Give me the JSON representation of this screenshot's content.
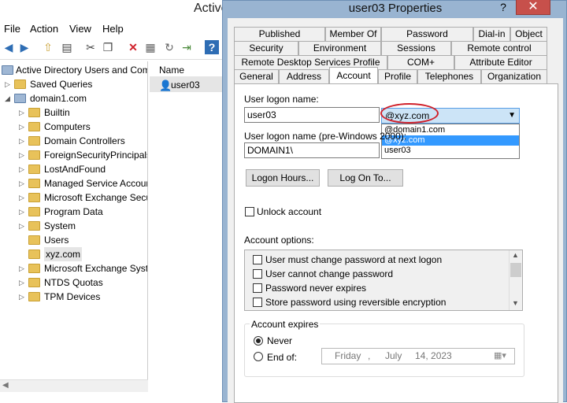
{
  "main": {
    "title": "Active",
    "menu": [
      "File",
      "Action",
      "View",
      "Help"
    ],
    "tree": [
      {
        "label": "Active Directory Users and Com",
        "expander": "",
        "icon": "ad-icon"
      },
      {
        "label": "Saved Queries",
        "expander": "▷",
        "icon": "folder-icon"
      },
      {
        "label": "domain1.com",
        "expander": "◢",
        "icon": "domain-icon"
      },
      {
        "label": "Builtin",
        "expander": "▷",
        "icon": "folder-icon"
      },
      {
        "label": "Computers",
        "expander": "▷",
        "icon": "folder-icon"
      },
      {
        "label": "Domain Controllers",
        "expander": "▷",
        "icon": "folder-icon"
      },
      {
        "label": "ForeignSecurityPrincipals",
        "expander": "▷",
        "icon": "folder-icon"
      },
      {
        "label": "LostAndFound",
        "expander": "▷",
        "icon": "folder-icon"
      },
      {
        "label": "Managed Service Accour",
        "expander": "▷",
        "icon": "folder-icon"
      },
      {
        "label": "Microsoft Exchange Secu",
        "expander": "▷",
        "icon": "folder-icon"
      },
      {
        "label": "Program Data",
        "expander": "▷",
        "icon": "folder-icon"
      },
      {
        "label": "System",
        "expander": "▷",
        "icon": "folder-icon"
      },
      {
        "label": "Users",
        "expander": "",
        "icon": "folder-icon"
      },
      {
        "label": "xyz.com",
        "expander": "",
        "icon": "ou-icon"
      },
      {
        "label": "Microsoft Exchange Syste",
        "expander": "▷",
        "icon": "folder-icon"
      },
      {
        "label": "NTDS Quotas",
        "expander": "▷",
        "icon": "folder-icon"
      },
      {
        "label": "TPM Devices",
        "expander": "▷",
        "icon": "folder-icon"
      }
    ],
    "list_header": "Name",
    "list_item": "user03"
  },
  "dialog": {
    "title": "user03 Properties",
    "help": "?",
    "close": "✕",
    "tabs_row1": [
      "Published Certificates",
      "Member Of",
      "Password Replication",
      "Dial-in",
      "Object"
    ],
    "tabs_row2": [
      "Security",
      "Environment",
      "Sessions",
      "Remote control"
    ],
    "tabs_row3": [
      "Remote Desktop Services Profile",
      "COM+",
      "Attribute Editor"
    ],
    "tabs_row4": [
      "General",
      "Address",
      "Account",
      "Profile",
      "Telephones",
      "Organization"
    ],
    "logon_label": "User logon name:",
    "logon_value": "user03",
    "domain_selected": "@xyz.com",
    "domain_options": [
      "@domain1.com",
      "@xyz.com",
      "user03"
    ],
    "pre2000_label": "User logon name (pre-Windows 2000):",
    "pre2000_value": "DOMAIN1\\",
    "logon_hours": "Logon Hours...",
    "logon_to": "Log On To...",
    "unlock": "Unlock account",
    "options_label": "Account options:",
    "options": [
      "User must change password at next logon",
      "User cannot change password",
      "Password never expires",
      "Store password using reversible encryption"
    ],
    "expires_label": "Account expires",
    "never": "Never",
    "end_of": "End of:",
    "date_day": "Friday",
    "date_sep": ",",
    "date_month": "July",
    "date_rest": "14, 2023"
  }
}
